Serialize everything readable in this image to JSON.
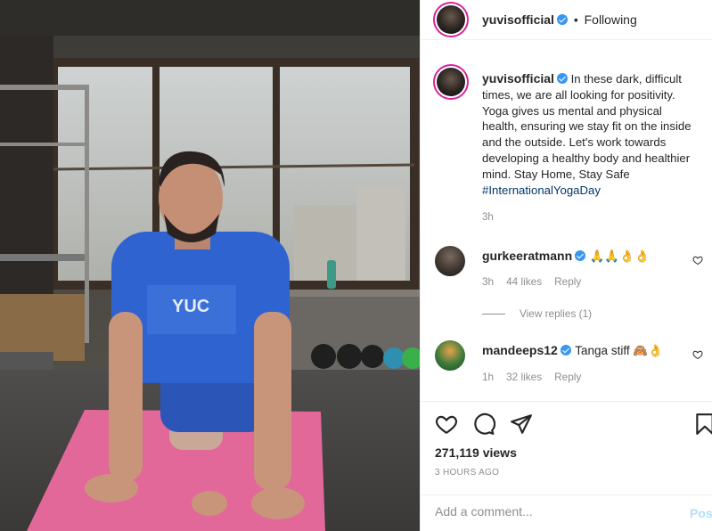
{
  "post": {
    "author": "yuvisofficial",
    "follow_state": "Following",
    "separator": "•",
    "caption": {
      "author": "yuvisofficial",
      "text": "In these dark, difficult times, we are all looking for positivity. Yoga gives us mental and physical health, ensuring we stay fit on the inside and the outside. Let's work towards developing a healthy body and healthier mind. Stay Home, Stay Safe",
      "hashtag": "#InternationalYogaDay",
      "time": "3h"
    },
    "comments": [
      {
        "user": "gurkeeratmann",
        "text": "🙏🙏👌👌",
        "time": "3h",
        "likes": "44 likes",
        "reply": "Reply"
      },
      {
        "user": "mandeeps12",
        "text": "Tanga stiff 🙈👌",
        "time": "1h",
        "likes": "32 likes",
        "reply": "Reply"
      }
    ],
    "view_replies": "View replies (1)",
    "views": "271,119 views",
    "posted": "3 HOURS AGO",
    "add_comment_placeholder": "Add a comment...",
    "post_button": "Post"
  },
  "icons": {
    "like": "heart-icon",
    "comment": "comment-icon",
    "share": "paper-plane-icon",
    "save": "bookmark-icon",
    "verified": "verified-badge-icon"
  },
  "colors": {
    "verified": "#3897f0",
    "hashtag": "#00376b",
    "secondary_text": "#8e8e8e",
    "post_button": "#b2dffc",
    "story_ring": "#d6249f"
  }
}
